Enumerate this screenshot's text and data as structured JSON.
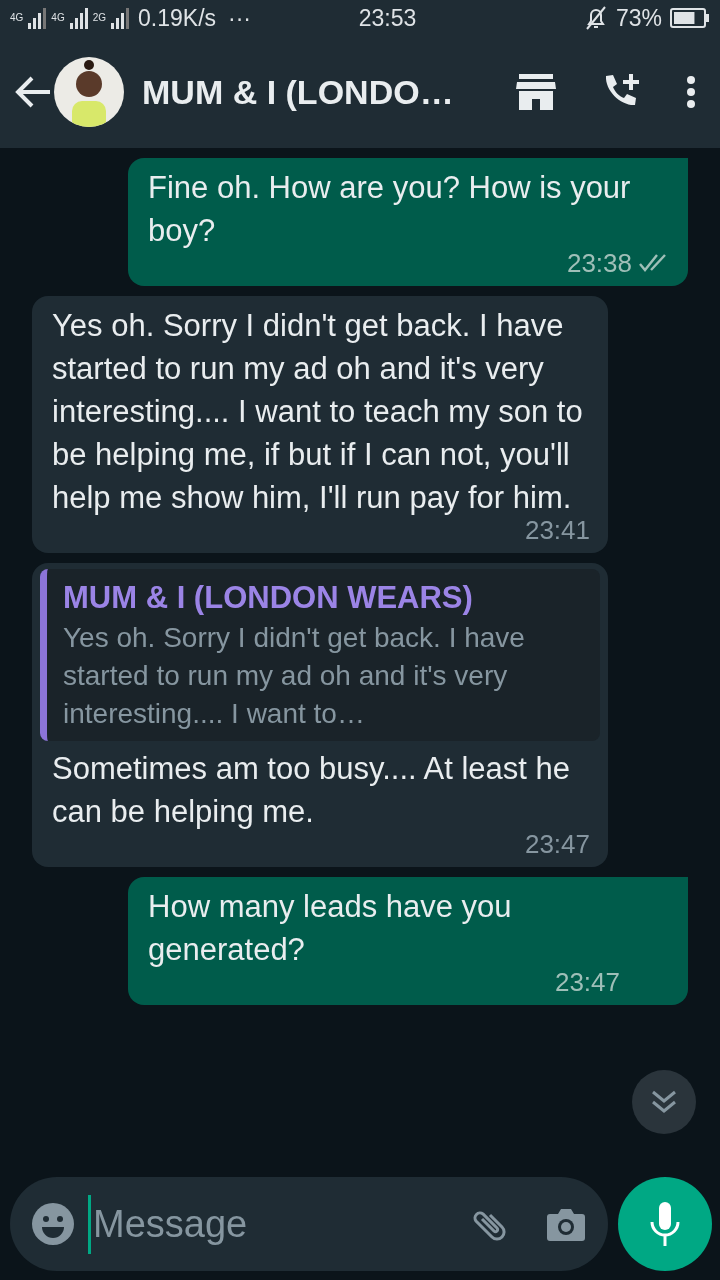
{
  "status_bar": {
    "network_labels": [
      "4G",
      "4G",
      "2G"
    ],
    "speed": "0.19K/s",
    "more": "···",
    "time": "23:53",
    "battery": "73%"
  },
  "header": {
    "title": "MUM & I (LONDO…"
  },
  "messages": [
    {
      "kind": "outgoing",
      "text": "Fine oh. How are you? How is your boy?",
      "time": "23:38",
      "delivered": true
    },
    {
      "kind": "incoming",
      "text": "Yes oh. Sorry I didn't get back. I have started to run my ad oh and it's very interesting.... I want to teach my son to be helping me, if but if I can not, you'll help me show him, I'll run pay for him.",
      "time": "23:41"
    },
    {
      "kind": "incoming",
      "quote": {
        "author": "MUM & I (LONDON WEARS)",
        "text": "Yes oh. Sorry I didn't get back. I have started to run my ad oh and it's very interesting.... I want to…"
      },
      "text": "Sometimes am too busy.... At least he can be helping me.",
      "time": "23:47"
    },
    {
      "kind": "outgoing",
      "text": "How many leads have you generated?",
      "time": "23:47"
    }
  ],
  "composer": {
    "placeholder": "Message"
  }
}
